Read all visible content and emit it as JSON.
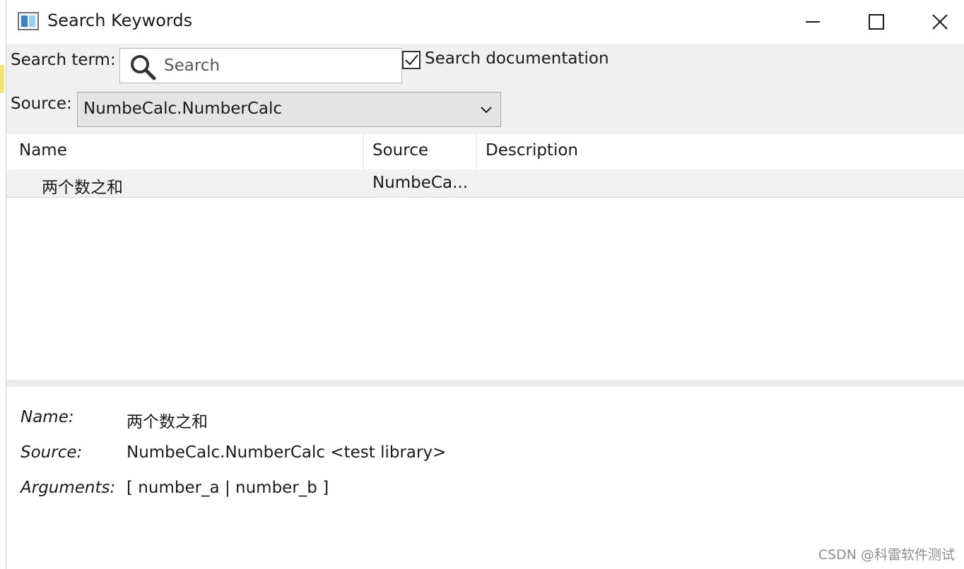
{
  "window": {
    "title": "Search Keywords"
  },
  "toolbar": {
    "search_term_label": "Search term:",
    "search_placeholder": "Search",
    "search_documentation_label": "Search documentation",
    "search_documentation_checked": true,
    "source_label": "Source:",
    "source_selected": "NumbeCalc.NumberCalc"
  },
  "table": {
    "columns": [
      "Name",
      "Source",
      "Description"
    ],
    "rows": [
      {
        "name": "两个数之和",
        "source": "NumbeCa...",
        "description": ""
      }
    ]
  },
  "details": {
    "name_label": "Name:",
    "name_value": "两个数之和",
    "source_label": "Source:",
    "source_value": "NumbeCalc.NumberCalc <test library>",
    "arguments_label": "Arguments:",
    "arguments_value": "[ number_a | number_b ]"
  },
  "watermark": "CSDN @科雷软件测试",
  "icons": {
    "app": "keyword-window-icon",
    "search": "search-icon",
    "minimize": "minimize-icon",
    "maximize": "maximize-icon",
    "close": "close-icon",
    "dropdown": "chevron-down-icon",
    "checkbox": "checkmark-icon"
  },
  "colors": {
    "toolbar_bg": "#f0f0f0",
    "select_bg": "#e4e4e4",
    "row_selected_bg": "#f1f1f1",
    "icon_blue": "#3b82c4"
  }
}
